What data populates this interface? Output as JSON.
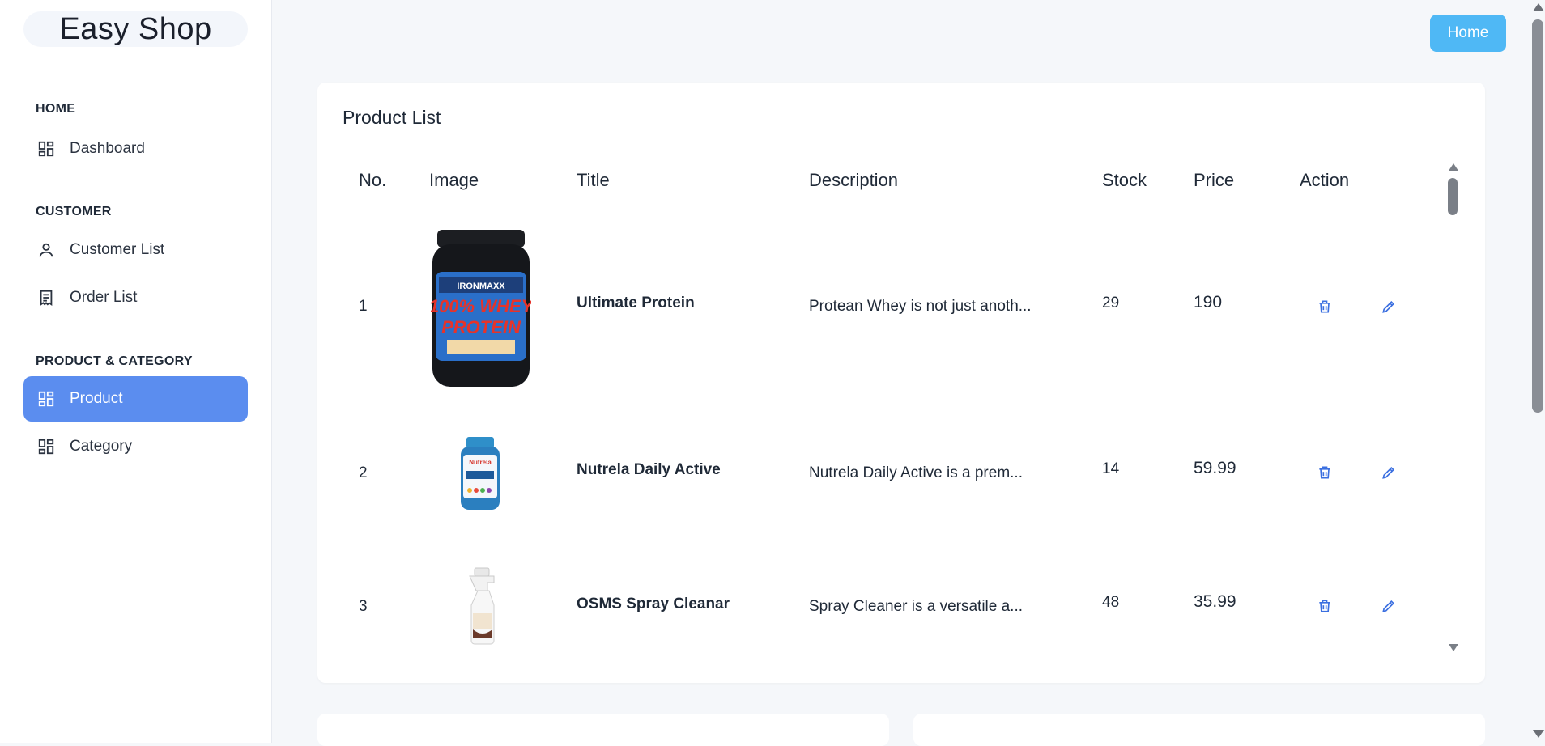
{
  "brand": "Easy Shop",
  "sidebar": {
    "sections": [
      {
        "title": "HOME",
        "items": [
          {
            "label": "Dashboard",
            "icon": "dashboard-icon"
          }
        ]
      },
      {
        "title": "CUSTOMER",
        "items": [
          {
            "label": "Customer List",
            "icon": "user-icon"
          },
          {
            "label": "Order List",
            "icon": "receipt-icon"
          }
        ]
      },
      {
        "title": "PRODUCT & CATEGORY",
        "items": [
          {
            "label": "Product",
            "icon": "dashboard-icon",
            "active": true
          },
          {
            "label": "Category",
            "icon": "dashboard-icon"
          }
        ]
      }
    ]
  },
  "header": {
    "home_label": "Home"
  },
  "product_list": {
    "title": "Product List",
    "columns": [
      "No.",
      "Image",
      "Title",
      "Description",
      "Stock",
      "Price",
      "Action"
    ],
    "rows": [
      {
        "no": "1",
        "title": "Ultimate Protein",
        "description": "Protean Whey is not just anoth...",
        "stock": "29",
        "price": "190",
        "image_icon": "protein-jar-image"
      },
      {
        "no": "2",
        "title": "Nutrela Daily Active",
        "description": "Nutrela Daily Active is a prem...",
        "stock": "14",
        "price": "59.99",
        "image_icon": "supplement-bottle-image"
      },
      {
        "no": "3",
        "title": "OSMS Spray Cleanar",
        "description": "Spray Cleaner is a versatile a...",
        "stock": "48",
        "price": "35.99",
        "image_icon": "spray-bottle-image"
      }
    ]
  },
  "colors": {
    "accent": "#5b8def",
    "home_button": "#4fb8f5",
    "action_icon": "#3b6fe0"
  }
}
